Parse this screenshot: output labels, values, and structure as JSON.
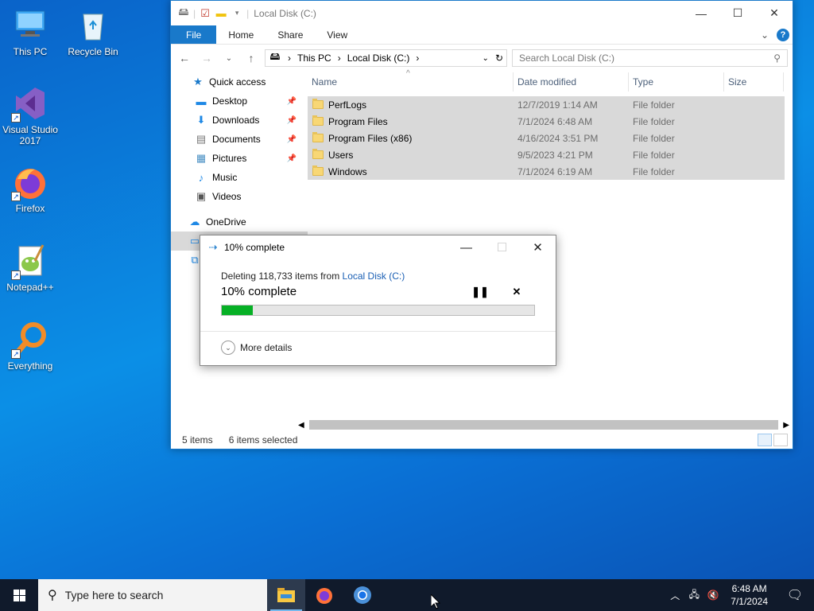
{
  "desktop": {
    "icons": [
      {
        "label": "This PC",
        "icon": "this-pc-icon"
      },
      {
        "label": "Recycle Bin",
        "icon": "recycle-bin-icon"
      },
      {
        "label": "Visual Studio 2017",
        "icon": "visual-studio-icon"
      },
      {
        "label": "Firefox",
        "icon": "firefox-icon"
      },
      {
        "label": "Notepad++",
        "icon": "notepadpp-icon"
      },
      {
        "label": "Everything",
        "icon": "everything-icon"
      }
    ]
  },
  "explorer": {
    "title": "Local Disk (C:)",
    "ribbon_tabs": [
      "File",
      "Home",
      "Share",
      "View"
    ],
    "address": {
      "segments": [
        "This PC",
        "Local Disk (C:)"
      ]
    },
    "search_placeholder": "Search Local Disk (C:)",
    "nav": {
      "quick_access": "Quick access",
      "items": [
        {
          "label": "Desktop",
          "pinned": true
        },
        {
          "label": "Downloads",
          "pinned": true
        },
        {
          "label": "Documents",
          "pinned": true
        },
        {
          "label": "Pictures",
          "pinned": true
        },
        {
          "label": "Music",
          "pinned": false
        },
        {
          "label": "Videos",
          "pinned": false
        }
      ],
      "onedrive": "OneDrive"
    },
    "columns": [
      "Name",
      "Date modified",
      "Type",
      "Size"
    ],
    "files": [
      {
        "name": "PerfLogs",
        "date": "12/7/2019 1:14 AM",
        "type": "File folder",
        "size": ""
      },
      {
        "name": "Program Files",
        "date": "7/1/2024 6:48 AM",
        "type": "File folder",
        "size": ""
      },
      {
        "name": "Program Files (x86)",
        "date": "4/16/2024 3:51 PM",
        "type": "File folder",
        "size": ""
      },
      {
        "name": "Users",
        "date": "9/5/2023 4:21 PM",
        "type": "File folder",
        "size": ""
      },
      {
        "name": "Windows",
        "date": "7/1/2024 6:19 AM",
        "type": "File folder",
        "size": ""
      }
    ],
    "status": {
      "items": "5 items",
      "selected": "6 items selected"
    }
  },
  "dialog": {
    "title": "10% complete",
    "line_prefix": "Deleting 118,733 items from ",
    "line_link": "Local Disk (C:)",
    "percent_text": "10% complete",
    "progress": 0.1,
    "more_details": "More details"
  },
  "taskbar": {
    "search_placeholder": "Type here to search",
    "time": "6:48 AM",
    "date": "7/1/2024"
  },
  "colors": {
    "accent": "#1979ca",
    "progress": "#06b025",
    "taskbar": "#101a2b"
  }
}
